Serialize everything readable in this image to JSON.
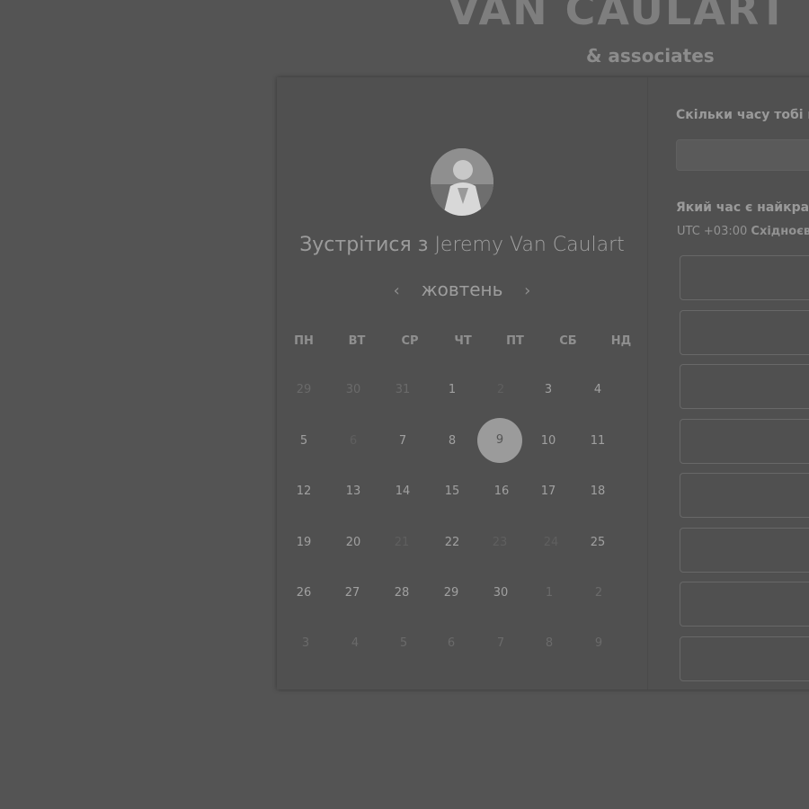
{
  "brand": {
    "logo": "VAN CAULART",
    "tagline": "& associates"
  },
  "booking": {
    "title_prefix": "Зустрітися з",
    "host_name": "Jeremy Van Caulart",
    "prev_icon": "‹",
    "next_icon": "›",
    "month": "жовтень"
  },
  "calendar": {
    "weekdays": [
      "ПН",
      "ВТ",
      "СР",
      "ЧТ",
      "ПТ",
      "СБ",
      "НД"
    ],
    "selected_day": "9",
    "weeks": [
      [
        "29",
        "30",
        "31",
        "1",
        "2",
        "3",
        "4"
      ],
      [
        "5",
        "6",
        "7",
        "8",
        "9",
        "10",
        "11"
      ],
      [
        "12",
        "13",
        "14",
        "15",
        "16",
        "17",
        "18"
      ],
      [
        "19",
        "20",
        "21",
        "22",
        "23",
        "24",
        "25"
      ],
      [
        "26",
        "27",
        "28",
        "29",
        "30",
        "1",
        "2"
      ],
      [
        "3",
        "4",
        "5",
        "6",
        "7",
        "8",
        "9"
      ]
    ]
  },
  "scheduler": {
    "duration_question": "Скільки часу тобі п",
    "time_question": "Який час є найкращ",
    "timezone_offset": "UTC +03:00",
    "timezone_name": "Східноєвр"
  },
  "colors": {
    "background": "#545454",
    "selected_day": "#9b9b9b"
  }
}
